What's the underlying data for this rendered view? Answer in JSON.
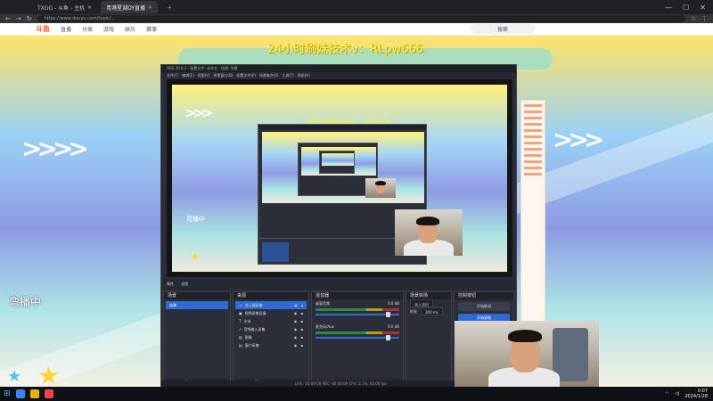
{
  "browser": {
    "tabs": [
      {
        "label": ""
      },
      {
        "label": ""
      },
      {
        "label": "TXGG - 斗鱼 - 主机"
      },
      {
        "label": "粤港星湖DY直播"
      }
    ],
    "url": "https://www.douyu.com/topic/..."
  },
  "site": {
    "logo": "斗鱼",
    "nav": [
      "直播",
      "分类",
      "游戏",
      "娱乐",
      "赛事"
    ],
    "search_label": "搜索"
  },
  "stream": {
    "overlay_title": "24小时刷妹技术v：RLpw666",
    "nested_title": "24小时刷妹技术v：RLpw666",
    "side_text": "弯播中",
    "nested_side_text": "弯播中"
  },
  "obs": {
    "window_title": "OBS 30.0.2 - 配置文件: 未命名 - 场景: 场景",
    "menu": [
      "文件(F)",
      "编辑(E)",
      "视图(V)",
      "停靠窗口(D)",
      "配置文件(P)",
      "场景集合(S)",
      "工具(T)",
      "帮助(H)"
    ],
    "controls": [
      "属性",
      "滤镜"
    ],
    "docks": {
      "scenes": {
        "title": "场景",
        "items": [
          "场景"
        ]
      },
      "sources": {
        "title": "来源",
        "items": [
          "显示器采集",
          "视频采集设备",
          "文本",
          "音频输入采集",
          "图像",
          "窗口采集"
        ]
      },
      "mixer": {
        "title": "混音器",
        "channels": [
          {
            "name": "桌面音频",
            "level": "0.0 dB"
          },
          {
            "name": "麦克风/Aux",
            "level": "0.0 dB"
          }
        ]
      },
      "transitions": {
        "title": "场景转场",
        "type": "淡入淡出",
        "duration_label": "时长",
        "duration": "300 ms"
      },
      "controls": {
        "title": "控制按钮",
        "buttons": [
          "开始推流",
          "开始录制",
          "启动虚拟摄像机",
          "工作室模式",
          "设置",
          "退出"
        ]
      }
    },
    "status": "LIVE: 00:00:00   REC: 00:00:00   CPU: 2.1%, 60.00 fps"
  },
  "taskbar": {
    "time": "0:07",
    "date": "2024/1/28"
  },
  "colors": {
    "obs_accent": "#2f6bd7",
    "overlay_text": "#ffef3a",
    "brand": "#ff5d23"
  }
}
